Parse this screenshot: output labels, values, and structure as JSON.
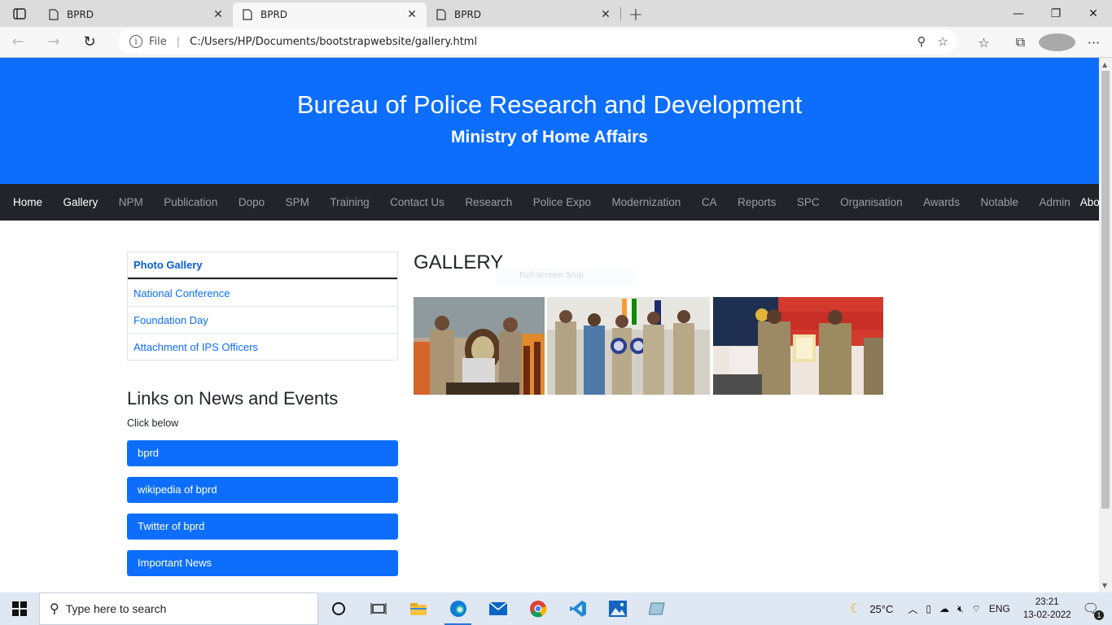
{
  "browser": {
    "tabs": [
      {
        "title": "BPRD",
        "active": false
      },
      {
        "title": "BPRD",
        "active": true
      },
      {
        "title": "BPRD",
        "active": false
      }
    ],
    "scheme_label": "File",
    "url": "C:/Users/HP/Documents/bootstrapwebsite/gallery.html"
  },
  "site": {
    "title": "Bureau of Police Research and Development",
    "subtitle": "Ministry of Home Affairs",
    "nav": [
      "Home",
      "Gallery",
      "NPM",
      "Publication",
      "Dopo",
      "SPM",
      "Training",
      "Contact Us",
      "Research",
      "Police Expo",
      "Modernization",
      "CA",
      "Reports",
      "SPC",
      "Organisation",
      "Awards",
      "Notable",
      "Admin",
      "About Us"
    ],
    "nav_active": [
      "Home",
      "Gallery",
      "About Us"
    ]
  },
  "sidebar": {
    "gallery_menu": [
      "Photo Gallery",
      "National Conference",
      "Foundation Day",
      "Attachment of IPS Officers"
    ],
    "news_title": "Links on News and Events",
    "news_sub": "Click below",
    "links": [
      "bprd",
      "wikipedia of bprd",
      "Twitter of bprd",
      "Important News"
    ]
  },
  "gallery": {
    "heading": "GALLERY",
    "overlay_text": "Full-screen Snip",
    "photos": [
      "trophy-ceremony-photo",
      "award-presentation-photo",
      "kerala-police-certificate-photo"
    ]
  },
  "taskbar": {
    "search_placeholder": "Type here to search",
    "weather": "25°C",
    "lang": "ENG",
    "time": "23:21",
    "date": "13-02-2022",
    "notif_count": "1"
  },
  "colors": {
    "primary": "#0d6efd",
    "navbar": "#212529"
  }
}
